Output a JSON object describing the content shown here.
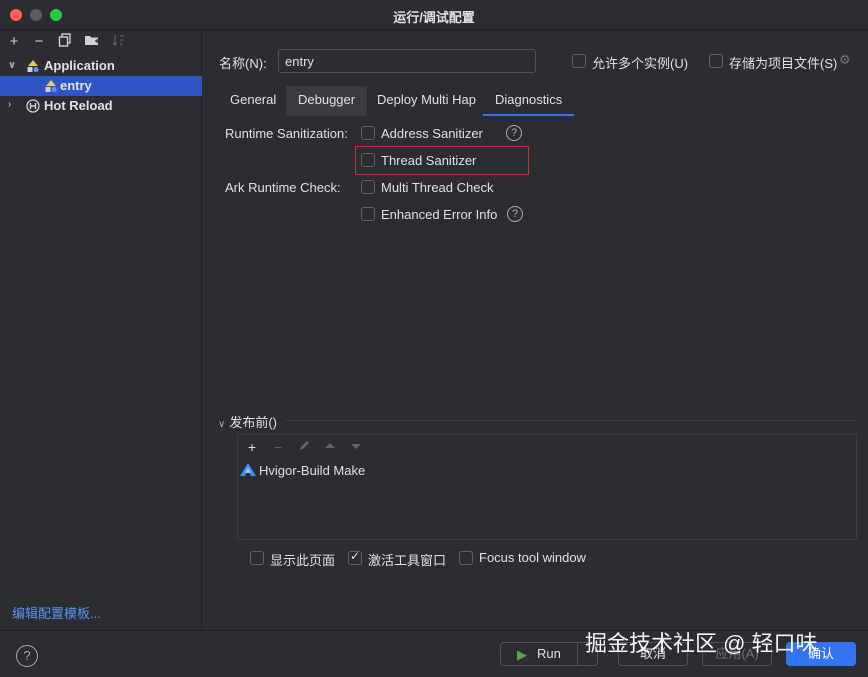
{
  "window": {
    "title": "运行/调试配置"
  },
  "sidebar": {
    "toolbar": [
      "add-icon",
      "remove-icon",
      "copy-icon",
      "folder-icon",
      "sort-icon"
    ],
    "tree": [
      {
        "label": "Application",
        "icon": "application-icon",
        "expanded": true
      },
      {
        "label": "entry",
        "icon": "entry-icon",
        "selected": true
      },
      {
        "label": "Hot Reload",
        "icon": "hot-reload-icon",
        "expanded": false
      }
    ],
    "edit_templates": "编辑配置模板..."
  },
  "header": {
    "name_label": "名称(N):",
    "name_value": "entry",
    "allow_multiple": "允许多个实例(U)",
    "store_as_project_file": "存储为项目文件(S)"
  },
  "tabs": [
    {
      "label": "General"
    },
    {
      "label": "Debugger"
    },
    {
      "label": "Deploy Multi Hap"
    },
    {
      "label": "Diagnostics"
    }
  ],
  "diagnostics": {
    "runtime_sanitization_label": "Runtime Sanitization:",
    "address_sanitizer": "Address Sanitizer",
    "thread_sanitizer": "Thread Sanitizer",
    "ark_runtime_check_label": "Ark Runtime Check:",
    "multi_thread_check": "Multi Thread Check",
    "enhanced_error_info": "Enhanced Error Info"
  },
  "before_launch": {
    "title": "发布前()",
    "tasks": [
      {
        "label": "Hvigor-Build Make",
        "icon": "hvigor-icon"
      }
    ],
    "show_page": "显示此页面",
    "activate_tool_window": "激活工具窗口",
    "focus_tool_window": "Focus tool window",
    "activate_checked": true
  },
  "footer": {
    "help": "?",
    "run": "Run",
    "cancel": "取消",
    "apply": "应用(A)",
    "ok": "确认"
  },
  "watermark": "掘金技术社区 @ 轻口味",
  "colors": {
    "accent": "#3574f0",
    "selection": "#2e55c3",
    "link": "#5a93f2",
    "highlight_border": "#b5383b"
  }
}
